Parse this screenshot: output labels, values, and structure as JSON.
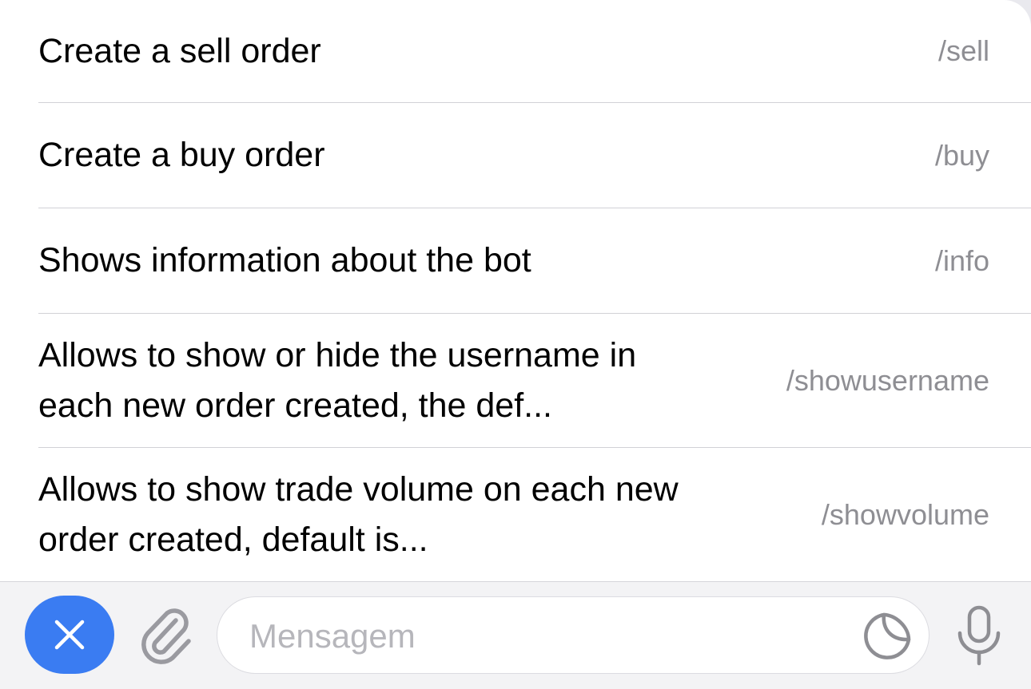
{
  "commands": [
    {
      "description": "Create a sell order",
      "command": "/sell"
    },
    {
      "description": "Create a buy order",
      "command": "/buy"
    },
    {
      "description": "Shows information about the bot",
      "command": "/info"
    },
    {
      "description": "Allows to show or hide the username in each new order created, the def...",
      "command": "/showusername"
    },
    {
      "description": "Allows to show trade volume on each new order created, default is...",
      "command": "/showvolume"
    }
  ],
  "composer": {
    "placeholder": "Mensagem",
    "value": "",
    "close_icon": "close-icon",
    "attach_icon": "paperclip-icon",
    "sticker_icon": "sticker-icon",
    "mic_icon": "microphone-icon"
  },
  "colors": {
    "accent": "#3a7cf2",
    "command_text": "#8e8e93"
  }
}
